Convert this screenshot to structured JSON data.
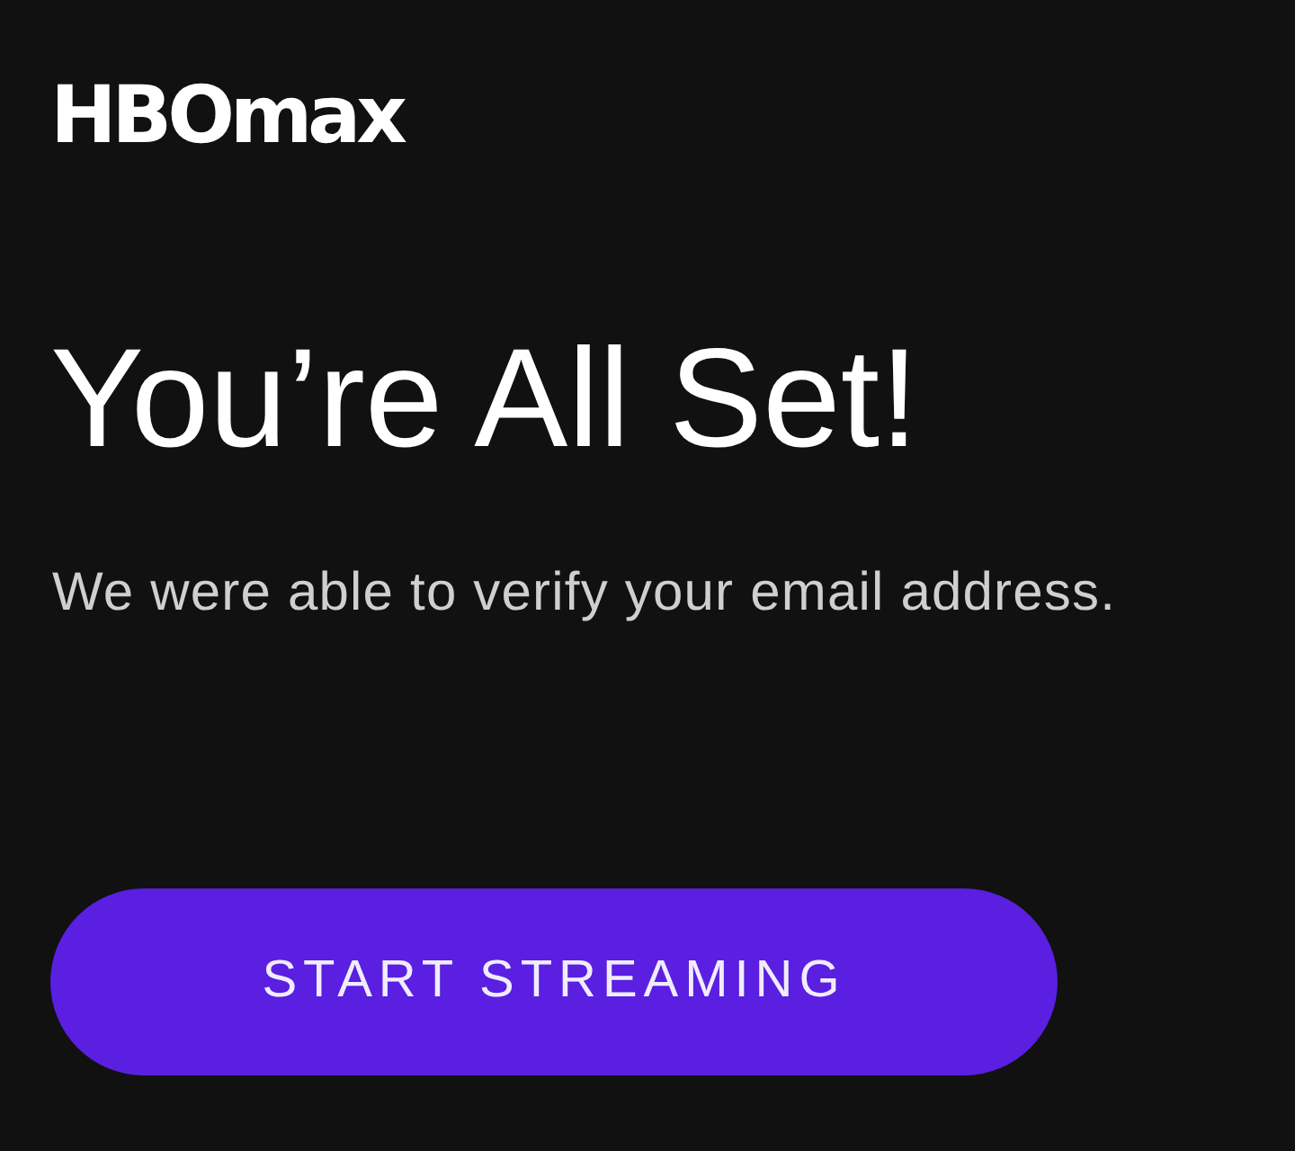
{
  "logo": {
    "text": "HBOmax"
  },
  "heading": "You’re All Set!",
  "message": "We were able to verify your email address.",
  "button": {
    "label": "START STREAMING"
  }
}
